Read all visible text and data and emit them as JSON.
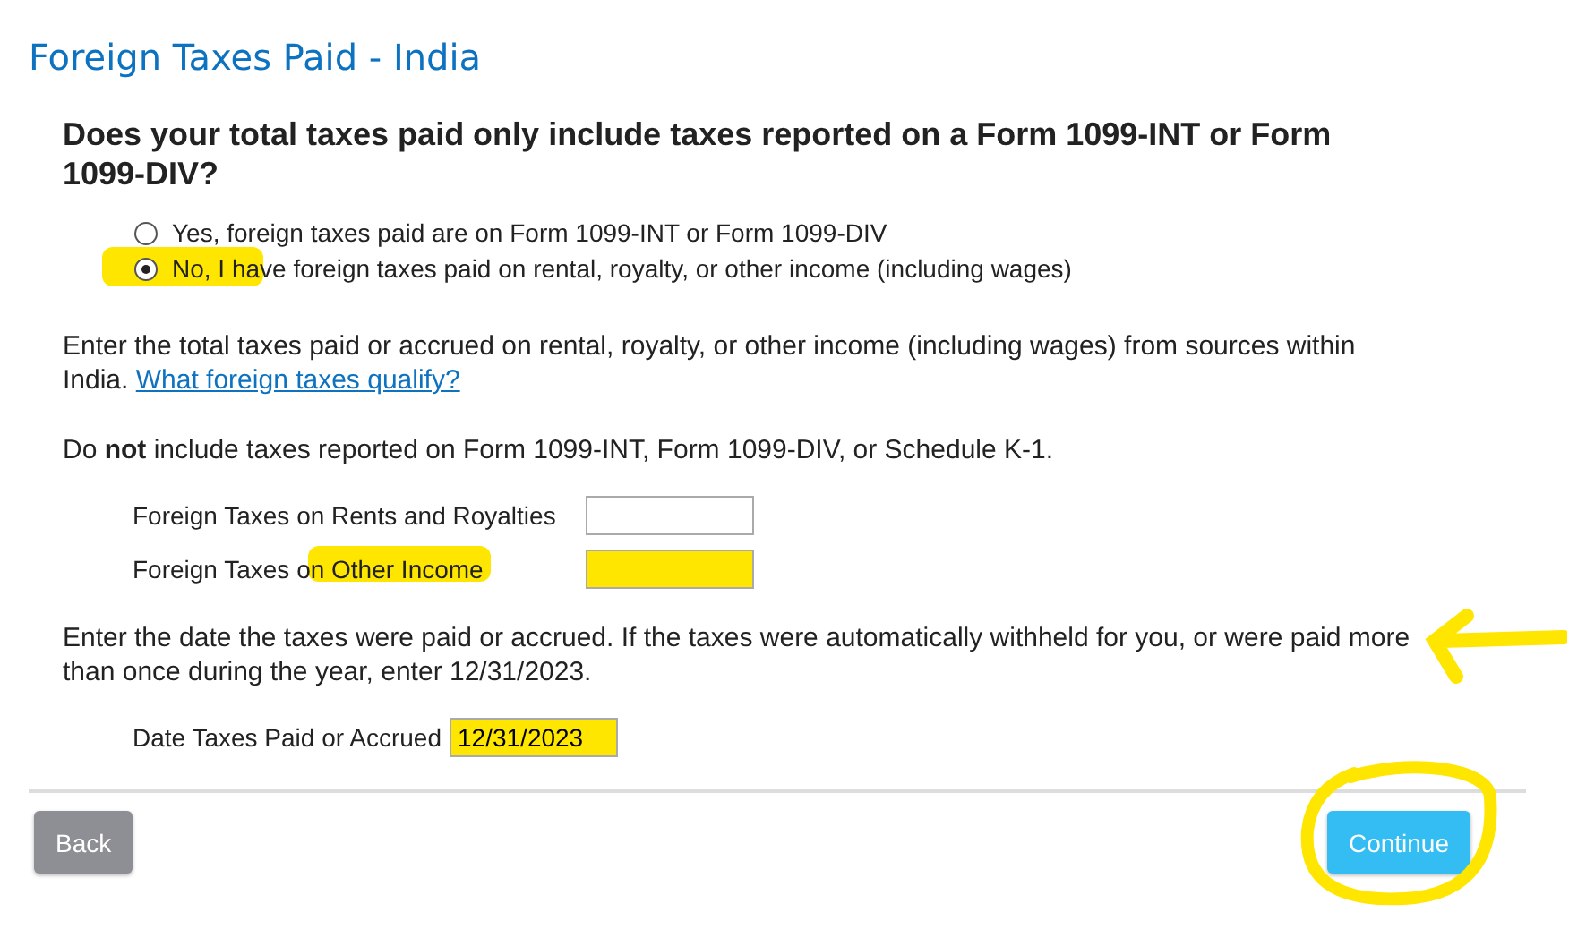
{
  "title": "Foreign Taxes Paid - India",
  "question": "Does your total taxes paid only include taxes reported on a Form 1099-INT or Form 1099-DIV?",
  "options": [
    {
      "label": "Yes, foreign taxes paid are on Form 1099-INT or Form 1099-DIV",
      "selected": false,
      "highlighted": false
    },
    {
      "label": "No, I have foreign taxes paid on rental, royalty, or other income (including wages)",
      "selected": true,
      "highlighted": true
    }
  ],
  "intro": {
    "text": "Enter the total taxes paid or accrued on rental, royalty, or other income (including wages) from sources within India.",
    "link": "What foreign taxes qualify?"
  },
  "note": "Do **not** include taxes reported on Form 1099-INT, Form 1099-DIV, or Schedule K-1.",
  "fields": [
    {
      "label": "Foreign Taxes on Rents and Royalties",
      "highlighted": false
    },
    {
      "label": "Foreign Taxes on Other Income",
      "highlighted": true
    }
  ],
  "date_note": "Enter the date the taxes were paid or accrued. If the taxes were automatically withheld for you, or were paid more than once during the year, enter 12/31/2023.",
  "date_field": {
    "label": "Date Taxes Paid or Accrued",
    "value": "12/31/2023",
    "highlighted": true
  },
  "buttons": [
    {
      "label": "Back",
      "kind": "back"
    },
    {
      "label": "Continue",
      "kind": "continue"
    }
  ],
  "annotations": {
    "arrow": true,
    "circle": true
  }
}
